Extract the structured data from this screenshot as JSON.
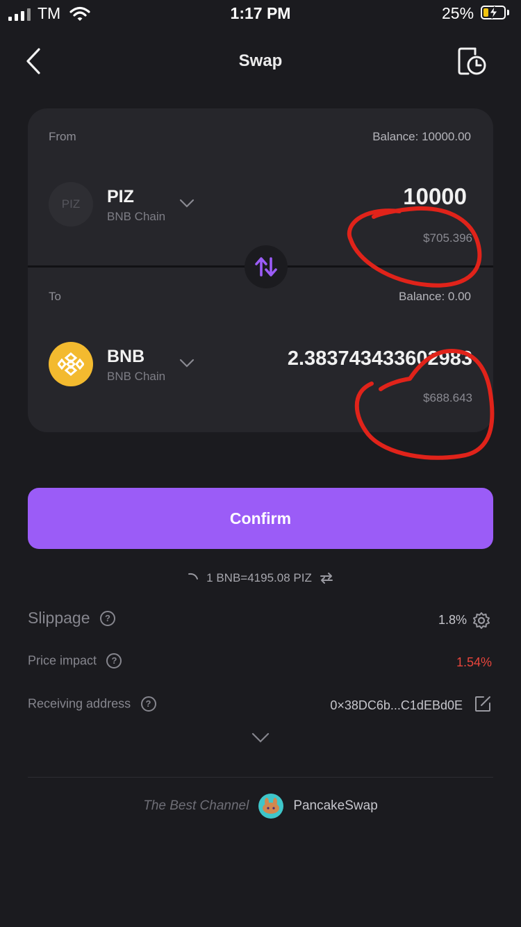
{
  "status_bar": {
    "carrier": "TM",
    "time": "1:17 PM",
    "battery_percent": "25%"
  },
  "header": {
    "title": "Swap",
    "back_icon": "chevron-left-icon",
    "history_icon": "history-icon"
  },
  "from": {
    "label": "From",
    "balance": "Balance: 10000.00",
    "token_symbol": "PIZ",
    "token_icon_text": "PIZ",
    "chain": "BNB Chain",
    "amount": "10000",
    "usd_value": "$705.396"
  },
  "to": {
    "label": "To",
    "balance": "Balance: 0.00",
    "token_symbol": "BNB",
    "chain": "BNB Chain",
    "amount": "2.383743433602983",
    "usd_value": "$688.643"
  },
  "confirm_label": "Confirm",
  "rate": "1 BNB=4195.08 PIZ",
  "details": {
    "slippage_label": "Slippage",
    "slippage_value": "1.8%",
    "price_impact_label": "Price impact",
    "price_impact_value": "1.54%",
    "receiving_address_label": "Receiving address",
    "receiving_address_value": "0×38DC6b...C1dEBd0E"
  },
  "footer": {
    "tagline": "The Best Channel",
    "provider": "PancakeSwap"
  },
  "colors": {
    "accent": "#9b5cf7",
    "negative": "#e8453c",
    "bnb": "#f3ba2f",
    "annotation": "#e0231a"
  }
}
